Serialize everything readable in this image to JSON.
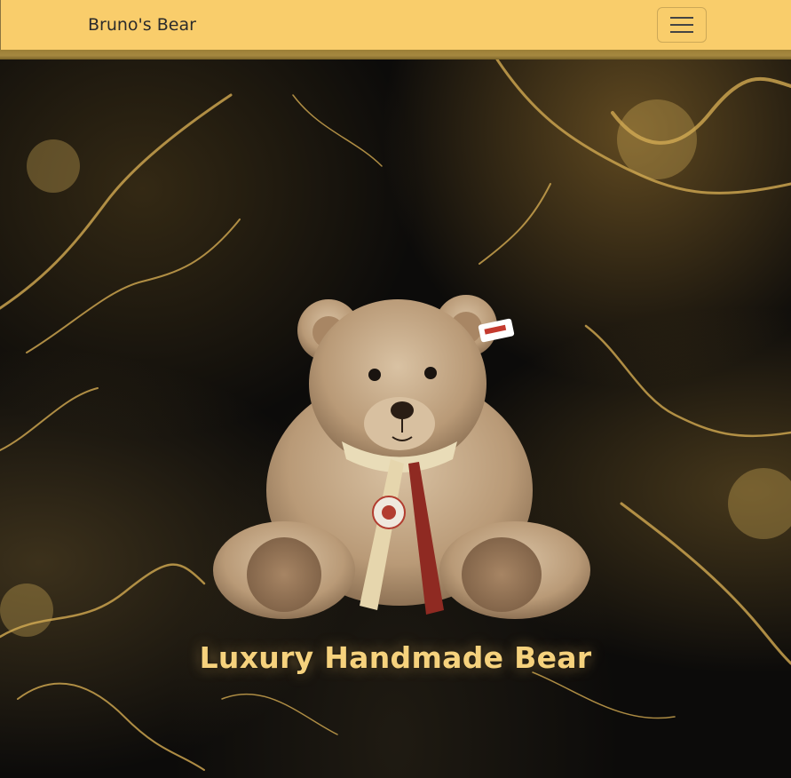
{
  "navbar": {
    "brand": "Bruno's Bear",
    "toggler_icon": "hamburger-menu-icon",
    "background_color": "#f9cd6b"
  },
  "hero": {
    "title": "Luxury Handmade Bear",
    "image": "teddy-bear-image",
    "background": "black-and-gold-marble",
    "title_color": "#f6d27d"
  }
}
